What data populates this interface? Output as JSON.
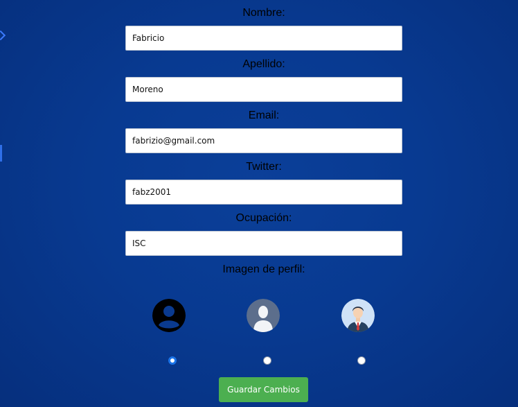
{
  "form": {
    "fields": [
      {
        "label": "Nombre:",
        "value": "Fabricio"
      },
      {
        "label": "Apellido:",
        "value": "Moreno"
      },
      {
        "label": "Email:",
        "value": "fabrizio@gmail.com"
      },
      {
        "label": "Twitter:",
        "value": "fabz2001"
      },
      {
        "label": "Ocupación:",
        "value": "ISC"
      }
    ],
    "profile_image_label": "Imagen de perfil:",
    "avatars": [
      {
        "icon": "person-silhouette-icon",
        "selected": true
      },
      {
        "icon": "default-user-icon",
        "selected": false
      },
      {
        "icon": "businessman-icon",
        "selected": false
      }
    ],
    "save_label": "Guardar Cambios"
  },
  "colors": {
    "background": "#083a91",
    "button": "#4caf50",
    "radio_selected": "#1a73e8"
  }
}
